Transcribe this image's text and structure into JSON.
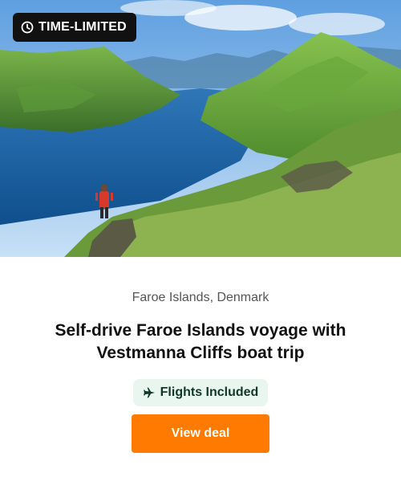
{
  "badge": {
    "label": "TIME-LIMITED",
    "icon": "clock-icon",
    "bg": "#111111"
  },
  "deal": {
    "location": "Faroe Islands, Denmark",
    "title": "Self-drive Faroe Islands voyage with Vestmanna Cliffs boat trip",
    "chip_label": "Flights Included",
    "chip_icon": "plane-icon",
    "cta_label": "View deal",
    "cta_color": "#ff7a00"
  }
}
